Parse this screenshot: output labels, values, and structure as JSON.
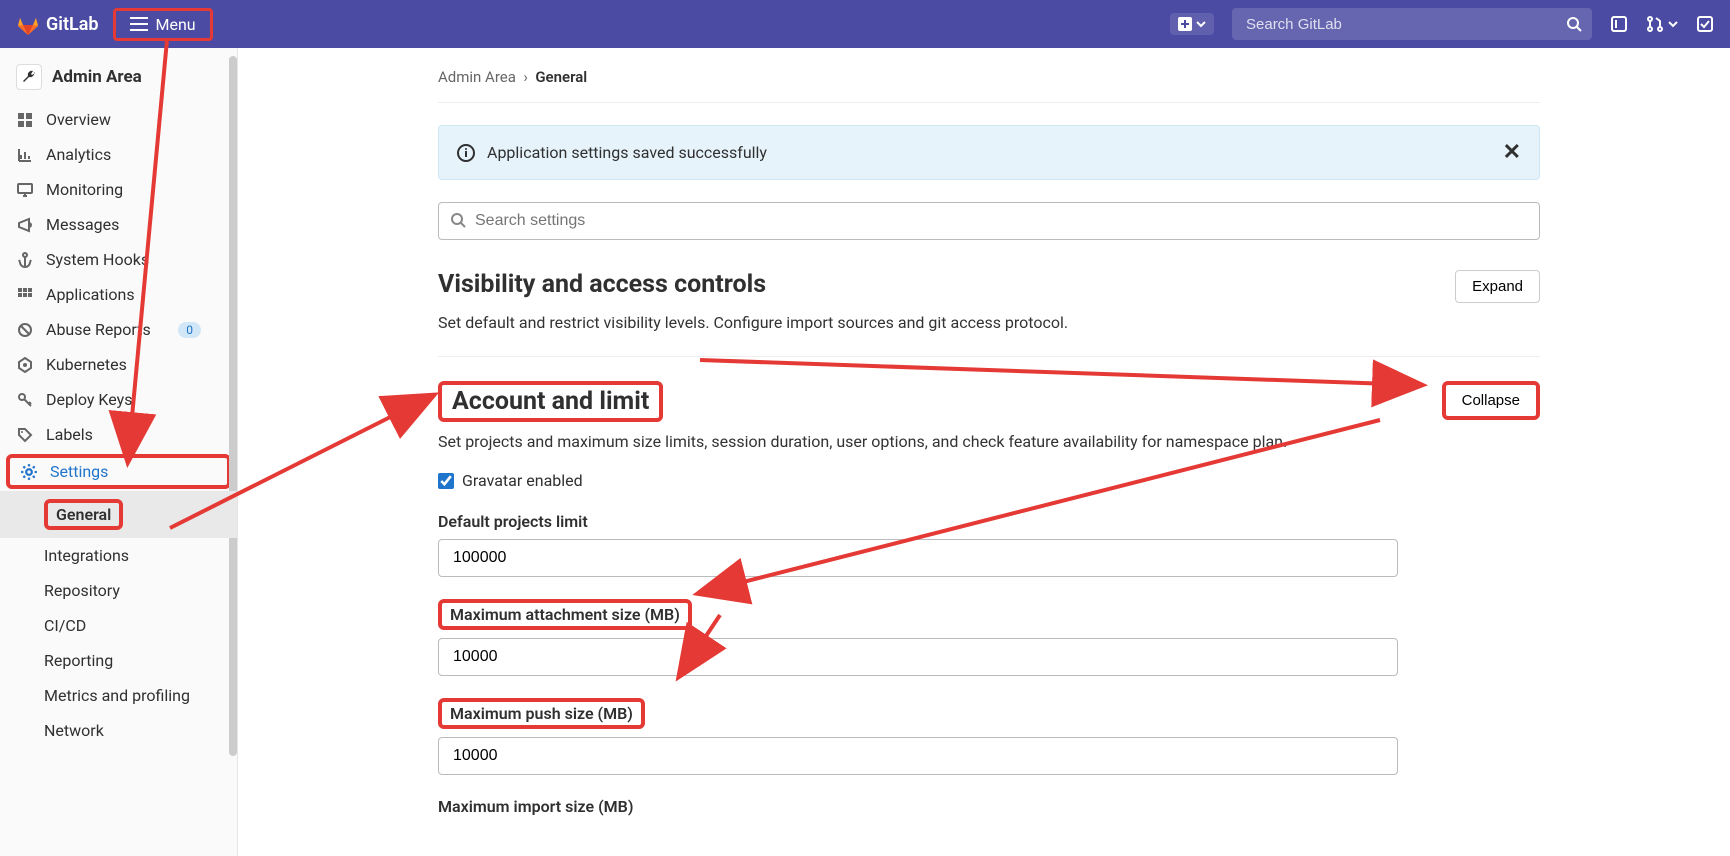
{
  "topbar": {
    "brand": "GitLab",
    "menu_label": "Menu",
    "search_placeholder": "Search GitLab"
  },
  "sidebar": {
    "title": "Admin Area",
    "items": [
      {
        "label": "Overview"
      },
      {
        "label": "Analytics"
      },
      {
        "label": "Monitoring"
      },
      {
        "label": "Messages"
      },
      {
        "label": "System Hooks"
      },
      {
        "label": "Applications"
      },
      {
        "label": "Abuse Reports",
        "badge": "0"
      },
      {
        "label": "Kubernetes"
      },
      {
        "label": "Deploy Keys"
      },
      {
        "label": "Labels"
      },
      {
        "label": "Settings"
      }
    ],
    "subitems": [
      {
        "label": "General"
      },
      {
        "label": "Integrations"
      },
      {
        "label": "Repository"
      },
      {
        "label": "CI/CD"
      },
      {
        "label": "Reporting"
      },
      {
        "label": "Metrics and profiling"
      },
      {
        "label": "Network"
      }
    ]
  },
  "breadcrumb": {
    "parent": "Admin Area",
    "sep": "›",
    "current": "General"
  },
  "alert": {
    "text": "Application settings saved successfully"
  },
  "search_settings": {
    "placeholder": "Search settings"
  },
  "sections": {
    "visibility": {
      "title": "Visibility and access controls",
      "desc": "Set default and restrict visibility levels. Configure import sources and git access protocol.",
      "button": "Expand"
    },
    "account": {
      "title": "Account and limit",
      "desc": "Set projects and maximum size limits, session duration, user options, and check feature availability for namespace plan.",
      "button": "Collapse",
      "gravatar_label": "Gravatar enabled",
      "fields": [
        {
          "label": "Default projects limit",
          "value": "100000"
        },
        {
          "label": "Maximum attachment size (MB)",
          "value": "10000"
        },
        {
          "label": "Maximum push size (MB)",
          "value": "10000"
        },
        {
          "label": "Maximum import size (MB)",
          "value": ""
        }
      ]
    }
  }
}
